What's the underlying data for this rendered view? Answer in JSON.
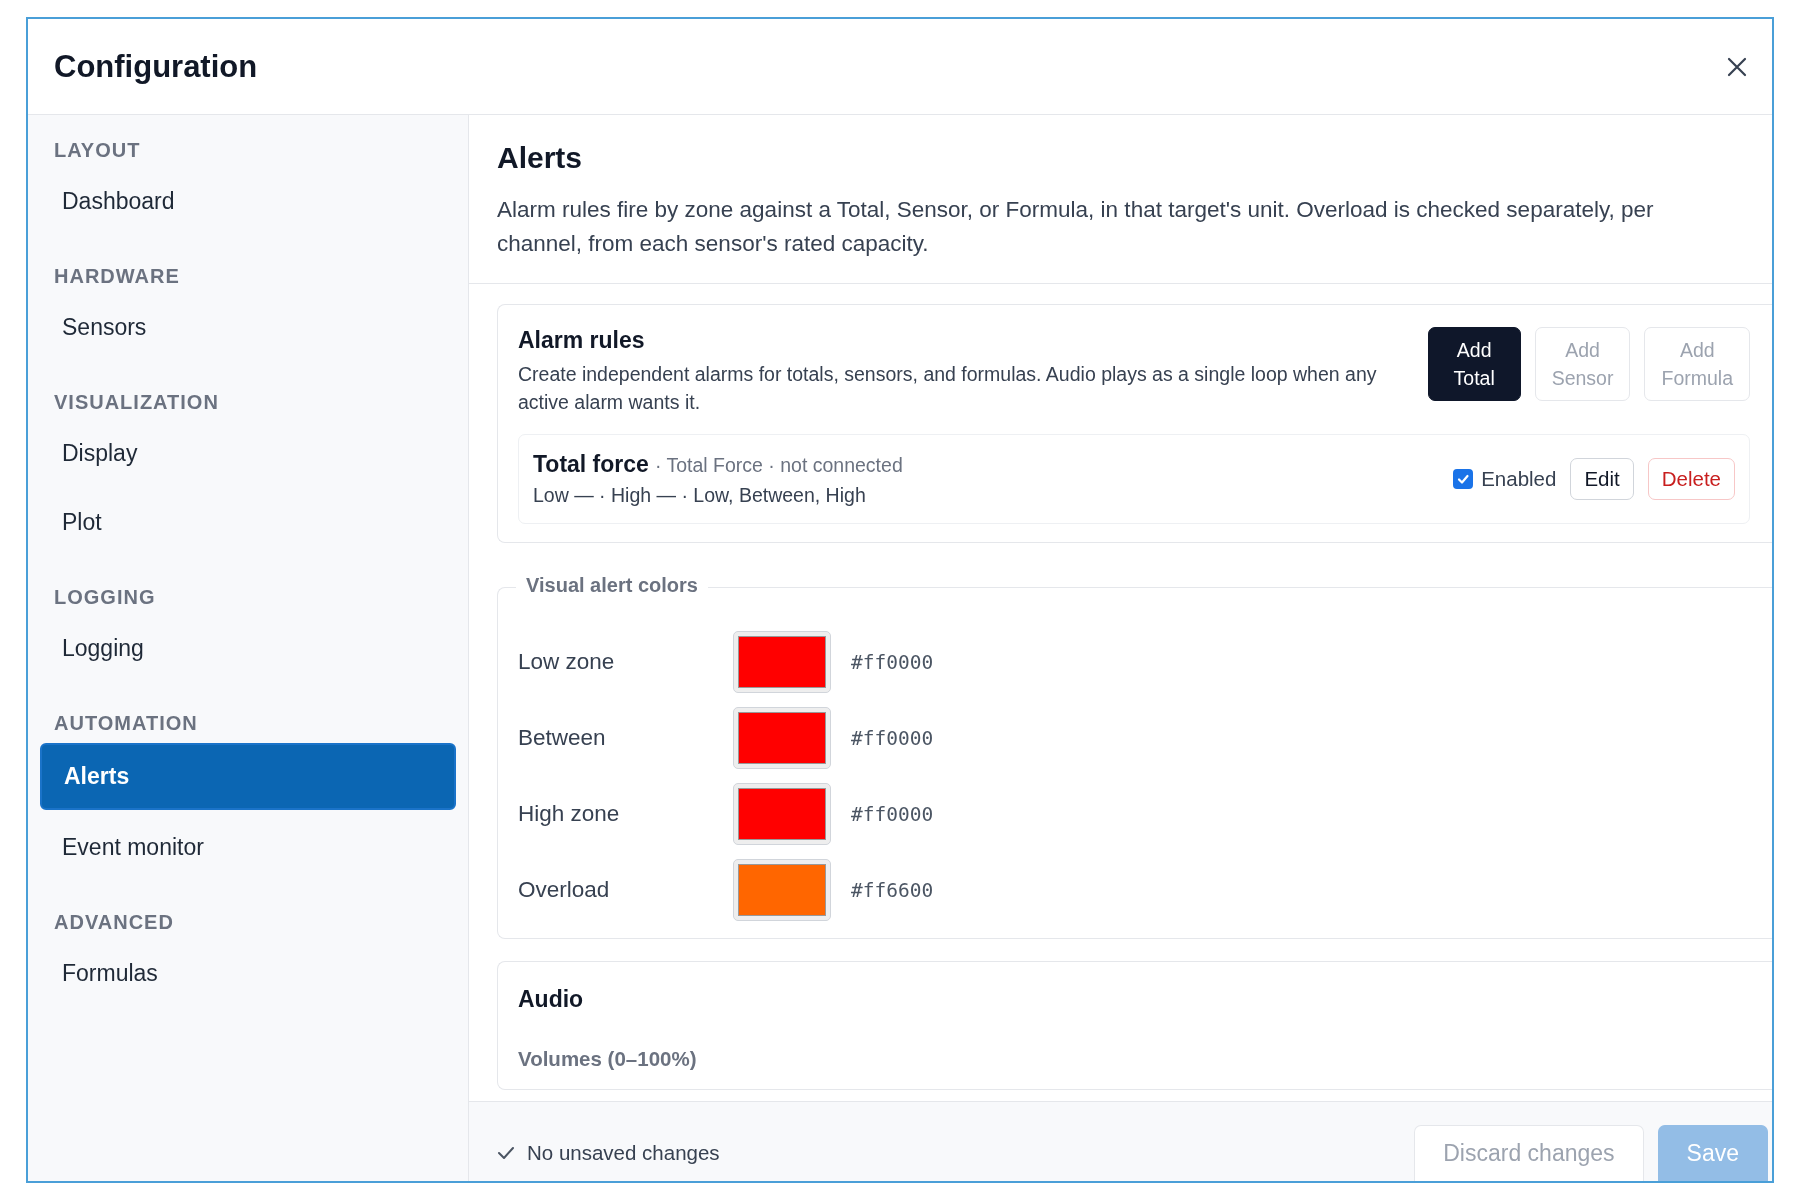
{
  "window": {
    "title": "Configuration"
  },
  "sidebar": {
    "groups": [
      {
        "heading": "LAYOUT",
        "items": [
          {
            "label": "Dashboard",
            "selected": false
          }
        ]
      },
      {
        "heading": "HARDWARE",
        "items": [
          {
            "label": "Sensors",
            "selected": false
          }
        ]
      },
      {
        "heading": "VISUALIZATION",
        "items": [
          {
            "label": "Display",
            "selected": false
          },
          {
            "label": "Plot",
            "selected": false
          }
        ]
      },
      {
        "heading": "LOGGING",
        "items": [
          {
            "label": "Logging",
            "selected": false
          }
        ]
      },
      {
        "heading": "AUTOMATION",
        "items": [
          {
            "label": "Alerts",
            "selected": true
          },
          {
            "label": "Event monitor",
            "selected": false
          }
        ]
      },
      {
        "heading": "ADVANCED",
        "items": [
          {
            "label": "Formulas",
            "selected": false
          }
        ]
      }
    ]
  },
  "page": {
    "title": "Alerts",
    "description": "Alarm rules fire by zone against a Total, Sensor, or Formula, in that target's unit. Overload is checked separately, per channel, from each sensor's rated capacity."
  },
  "alarm_rules": {
    "title": "Alarm rules",
    "description": "Create independent alarms for totals, sensors, and formulas. Audio plays as a single loop when any active alarm wants it.",
    "buttons": [
      {
        "line1": "Add",
        "line2": "Total",
        "disabled": false
      },
      {
        "line1": "Add",
        "line2": "Sensor",
        "disabled": true
      },
      {
        "line1": "Add",
        "line2": "Formula",
        "disabled": true
      }
    ],
    "rules": [
      {
        "name": "Total force",
        "meta": "· Total Force · not connected",
        "summary": "Low — · High — · Low, Between, High",
        "enabled": true,
        "enabled_label": "Enabled",
        "edit": "Edit",
        "delete": "Delete"
      }
    ]
  },
  "visual_alert_colors": {
    "title": "Visual alert colors",
    "rows": [
      {
        "label": "Low zone",
        "color": "#ff0000",
        "hex": "#ff0000"
      },
      {
        "label": "Between",
        "color": "#ff0000",
        "hex": "#ff0000"
      },
      {
        "label": "High zone",
        "color": "#ff0000",
        "hex": "#ff0000"
      },
      {
        "label": "Overload",
        "color": "#ff6600",
        "hex": "#ff6600"
      }
    ]
  },
  "audio": {
    "title": "Audio",
    "subtitle": "Volumes (0–100%)"
  },
  "footer": {
    "status": "No unsaved changes",
    "buttons": [
      {
        "label": "Discard changes",
        "kind": "secondary",
        "disabled": true
      },
      {
        "label": "Save",
        "kind": "primary",
        "disabled": true
      }
    ]
  }
}
